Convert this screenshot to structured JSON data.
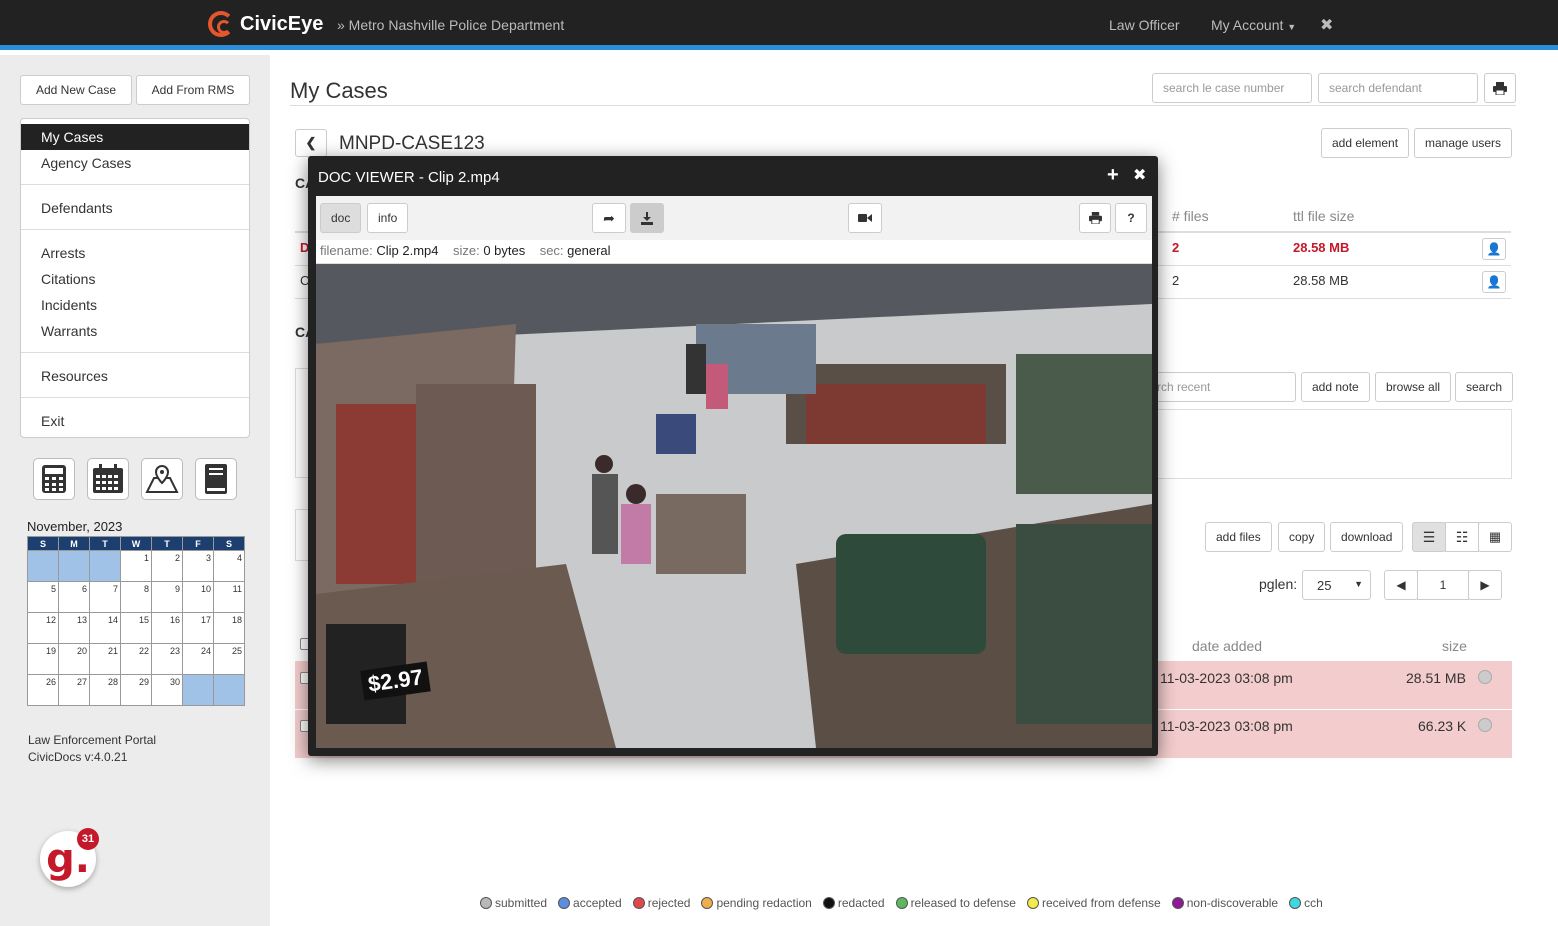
{
  "topbar": {
    "brand": "CivicEye",
    "department": "» Metro Nashville Police Department",
    "role": "Law Officer",
    "account": "My Account",
    "close_glyph": "✖"
  },
  "sidebar": {
    "add_new_case": "Add New Case",
    "add_from_rms": "Add From RMS",
    "menu": [
      "My Cases",
      "Agency Cases",
      "Defendants",
      "Arrests",
      "Citations",
      "Incidents",
      "Warrants",
      "Resources",
      "Exit"
    ],
    "tools": [
      "calculator-icon",
      "calendar-icon",
      "map-icon",
      "book-icon"
    ],
    "calendar": {
      "title": "November, 2023",
      "days": [
        "S",
        "M",
        "T",
        "W",
        "T",
        "F",
        "S"
      ],
      "weeks": [
        [
          "",
          "",
          "",
          "1",
          "2",
          "3",
          "4"
        ],
        [
          "5",
          "6",
          "7",
          "8",
          "9",
          "10",
          "11"
        ],
        [
          "12",
          "13",
          "14",
          "15",
          "16",
          "17",
          "18"
        ],
        [
          "19",
          "20",
          "21",
          "22",
          "23",
          "24",
          "25"
        ],
        [
          "26",
          "27",
          "28",
          "29",
          "30",
          "",
          ""
        ]
      ]
    },
    "footer_line1": "Law Enforcement Portal",
    "footer_line2": "CivicDocs v:4.0.21",
    "badge_letter": "g.",
    "badge_count": "31"
  },
  "main": {
    "title": "My Cases",
    "search_case_placeholder": "search le case number",
    "search_defendant_placeholder": "search defendant",
    "case_name": "MNPD-CASE123",
    "add_element": "add element",
    "manage_users": "manage users",
    "partial_label_1": "CA",
    "partial_label_2": "CA",
    "col_files": "# files",
    "col_size": "ttl file size",
    "rows": [
      {
        "prefix": "D",
        "files": "2",
        "size": "28.58 MB"
      },
      {
        "prefix": "C",
        "files": "2",
        "size": "28.58 MB"
      }
    ],
    "search_recent_placeholder": "rch recent",
    "add_note": "add note",
    "browse_all": "browse all",
    "search": "search",
    "add_files": "add files",
    "copy": "copy",
    "download": "download",
    "pglen_label": "pglen:",
    "pglen_value": "25",
    "page_value": "1",
    "col_date_added": "date added",
    "col_file_size": "size",
    "files": [
      {
        "date": "11-03-2023 03:08 pm",
        "size": "28.51 MB"
      },
      {
        "date": "11-03-2023 03:08 pm",
        "size": "66.23 K"
      }
    ]
  },
  "legend": [
    {
      "label": "submitted",
      "color": "#b9b9b9"
    },
    {
      "label": "accepted",
      "color": "#5b8de0"
    },
    {
      "label": "rejected",
      "color": "#e0474c"
    },
    {
      "label": "pending redaction",
      "color": "#f0ad4e"
    },
    {
      "label": "redacted",
      "color": "#111111"
    },
    {
      "label": "released to defense",
      "color": "#5cb85c"
    },
    {
      "label": "received from defense",
      "color": "#f5e94b"
    },
    {
      "label": "non-discoverable",
      "color": "#8e1a95"
    },
    {
      "label": "cch",
      "color": "#3fd8e0"
    }
  ],
  "viewer": {
    "title": "DOC VIEWER - Clip 2.mp4",
    "tab_doc": "doc",
    "tab_info": "info",
    "help": "?",
    "filename_label": "filename:",
    "filename": "Clip 2.mp4",
    "size_label": "size:",
    "size": "0 bytes",
    "sec_label": "sec:",
    "sec": "general",
    "price_sign": "$2.97"
  },
  "colors": {
    "accent_blue": "#2a8fd8",
    "brand_orange": "#e4572e",
    "row_pink": "#f3cccd",
    "danger_red": "#c4182b"
  }
}
